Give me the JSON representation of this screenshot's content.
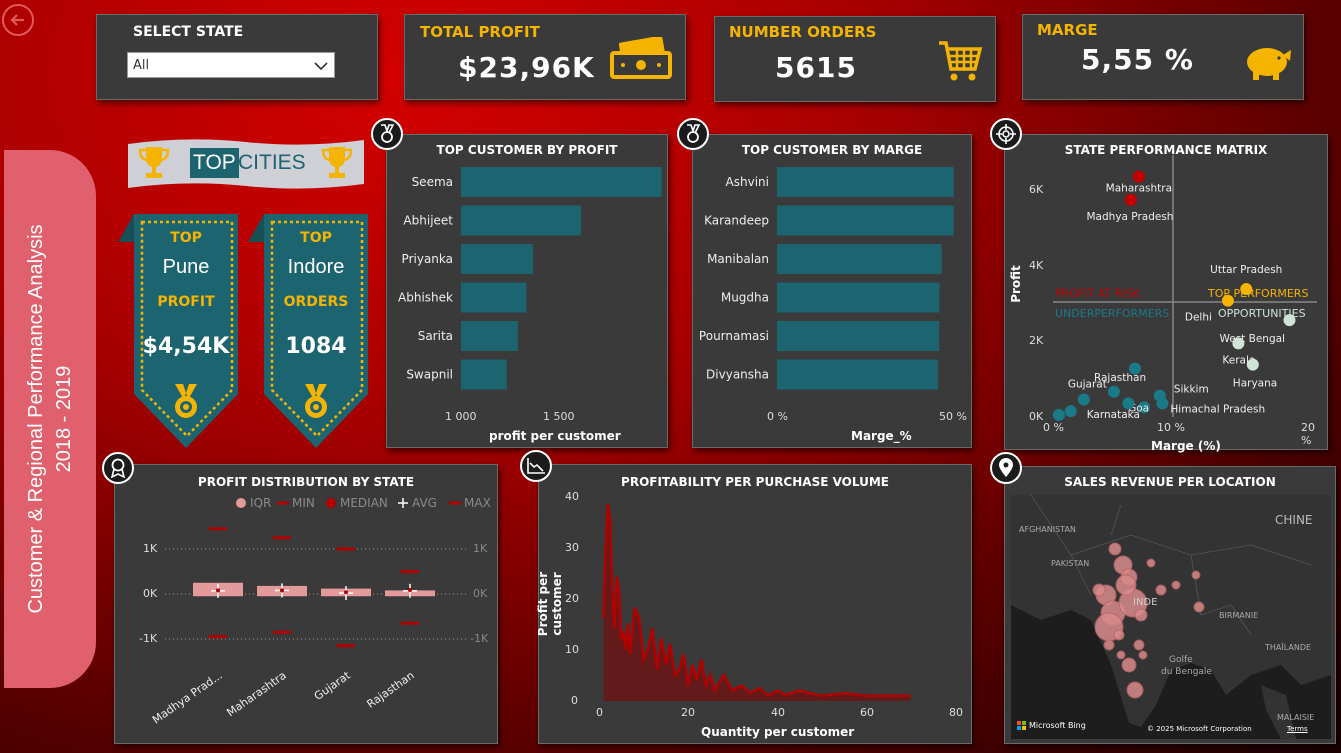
{
  "sidebar": {
    "title_line1": "Customer & Regional Performance Analysis",
    "title_line2": "2018 - 2019"
  },
  "filter": {
    "label": "SELECT STATE",
    "selected": "All"
  },
  "kpis": {
    "profit_label": "TOTAL PROFIT",
    "profit_value": "$23,96K",
    "orders_label": "NUMBER ORDERS",
    "orders_value": "5615",
    "marge_label": "MARGE",
    "marge_value": "5,55 %"
  },
  "top_cities": {
    "banner_top": "TOP",
    "banner_cities": "CITIES",
    "card1": {
      "top": "TOP",
      "city": "Pune",
      "metric": "PROFIT",
      "value": "$4,54K"
    },
    "card2": {
      "top": "TOP",
      "city": "Indore",
      "metric": "ORDERS",
      "value": "1084"
    }
  },
  "colors": {
    "teal": "#1b6470",
    "gold": "#f5b400",
    "dark_red": "#b30000",
    "panel": "#3a3a3a"
  },
  "charts": {
    "profit_by_customer": {
      "title": "TOP CUSTOMER BY PROFIT",
      "xlabel": "profit per customer",
      "ticks": [
        "1 000",
        "1 500"
      ]
    },
    "marge_by_customer": {
      "title": "TOP CUSTOMER BY MARGE",
      "xlabel": "Marge_%",
      "ticks": [
        "0 %",
        "50 %"
      ]
    },
    "matrix": {
      "title": "STATE PERFORMANCE MATRIX",
      "xlabel": "Marge (%)",
      "ylabel": "Profit",
      "yticks": [
        "0K",
        "2K",
        "4K",
        "6K"
      ],
      "xticks": [
        "0 %",
        "10 %",
        "20 %"
      ],
      "quadrants": {
        "risk": "PROFIT AT RISK",
        "top": "TOP PERFORMERS",
        "under": "UNDERPERFORMERS",
        "opp": "OPPORTUNITIES"
      }
    },
    "distribution": {
      "title": "PROFIT DISTRIBUTION BY STATE",
      "legend": [
        "IQR",
        "MIN",
        "MEDIAN",
        "AVG",
        "MAX"
      ],
      "yticks": [
        "1K",
        "0K",
        "-1K"
      ]
    },
    "volume": {
      "title": "PROFITABILITY PER PURCHASE VOLUME",
      "xlabel": "Quantity per customer",
      "ylabel": "Profit per customer",
      "yticks": [
        "40",
        "30",
        "20",
        "10",
        "0"
      ],
      "xticks": [
        "0",
        "20",
        "40",
        "60",
        "80"
      ]
    },
    "map": {
      "title": "SALES REVENUE PER LOCATION",
      "labels": {
        "afghanistan": "AFGHANISTAN",
        "pakistan": "PAKISTAN",
        "chine": "CHINE",
        "inde": "INDE",
        "birmanie": "BIRMANIE",
        "thailande": "THAÏLANDE",
        "golfe1": "Golfe",
        "golfe2": "du Bengale",
        "malaisie": "MALAISIE"
      },
      "bing": "Microsoft Bing",
      "copyright": "© 2025 Microsoft Corporation",
      "terms": "Terms"
    }
  },
  "chart_data": [
    {
      "type": "bar",
      "title": "TOP CUSTOMER BY PROFIT",
      "xlabel": "profit per customer",
      "categories": [
        "Seema",
        "Abhijeet",
        "Priyanka",
        "Abhishek",
        "Sarita",
        "Swapnil"
      ],
      "values": [
        1920,
        1550,
        1330,
        1300,
        1260,
        1210
      ],
      "xlim": [
        1000,
        2000
      ]
    },
    {
      "type": "bar",
      "title": "TOP CUSTOMER BY MARGE",
      "xlabel": "Marge_%",
      "categories": [
        "Ashvini",
        "Karandeep",
        "Manibalan",
        "Mugdha",
        "Pournamasi",
        "Divyansha"
      ],
      "values": [
        49.9,
        49.9,
        46.5,
        45.9,
        45.8,
        45.5
      ],
      "xlim": [
        0,
        50
      ]
    },
    {
      "type": "scatter",
      "title": "STATE PERFORMANCE MATRIX",
      "xlabel": "Marge (%)",
      "ylabel": "Profit",
      "xlim": [
        0,
        20
      ],
      "ylim": [
        0,
        6500
      ],
      "points": [
        {
          "label": "Maharashtra",
          "x": 6.4,
          "y": 6200,
          "color": "#c40000"
        },
        {
          "label": "Madhya Pradesh",
          "x": 5.8,
          "y": 5600,
          "color": "#c40000"
        },
        {
          "label": "Uttar Pradesh",
          "x": 14.6,
          "y": 3300,
          "color": "#f5b400"
        },
        {
          "label": "Delhi",
          "x": 13.2,
          "y": 3000,
          "color": "#f5b400"
        },
        {
          "label": "West Bengal",
          "x": 17.9,
          "y": 2500,
          "color": "#cfe3d6"
        },
        {
          "label": "Kerala",
          "x": 14.0,
          "y": 1900,
          "color": "#cfe3d6"
        },
        {
          "label": "Haryana",
          "x": 15.1,
          "y": 1350,
          "color": "#cfe3d6"
        },
        {
          "label": "Gujarat",
          "x": 2.2,
          "y": 450,
          "color": "#1b7a88"
        },
        {
          "label": "Rajasthan",
          "x": 4.5,
          "y": 650,
          "color": "#1b7a88"
        },
        {
          "label": "",
          "x": 6.1,
          "y": 1250,
          "color": "#1b7a88"
        },
        {
          "label": "Sikkim",
          "x": 8.0,
          "y": 550,
          "color": "#1b7a88"
        },
        {
          "label": "Goa",
          "x": 6.8,
          "y": 250,
          "color": "#1b7a88"
        },
        {
          "label": "Himachal Pradesh",
          "x": 8.2,
          "y": 350,
          "color": "#1b7a88"
        },
        {
          "label": "Karnataka",
          "x": 1.2,
          "y": 150,
          "color": "#1b7a88"
        },
        {
          "label": "",
          "x": 0.3,
          "y": 50,
          "color": "#1b7a88"
        },
        {
          "label": "",
          "x": 5.6,
          "y": 350,
          "color": "#1b7a88"
        }
      ]
    },
    {
      "type": "box",
      "title": "PROFIT DISTRIBUTION BY STATE",
      "categories": [
        "Madhya Prad...",
        "Maharashtra",
        "Gujarat",
        "Rajasthan"
      ],
      "series": [
        {
          "name": "MIN",
          "values": [
            -950,
            -850,
            -1150,
            -650
          ]
        },
        {
          "name": "IQR",
          "values": [
            [
              -50,
              250
            ],
            [
              -50,
              180
            ],
            [
              -50,
              120
            ],
            [
              -50,
              80
            ]
          ]
        },
        {
          "name": "MEDIAN",
          "values": [
            80,
            80,
            40,
            90
          ]
        },
        {
          "name": "AVG",
          "values": [
            70,
            80,
            20,
            70
          ]
        },
        {
          "name": "MAX",
          "values": [
            1450,
            1250,
            1000,
            500
          ]
        }
      ],
      "ylim": [
        -1300,
        1700
      ]
    },
    {
      "type": "area",
      "title": "PROFITABILITY PER PURCHASE VOLUME",
      "xlabel": "Quantity per customer",
      "ylabel": "Profit per customer",
      "xlim": [
        0,
        80
      ],
      "ylim": [
        0,
        42
      ],
      "x": [
        1,
        1.5,
        2,
        2.5,
        3,
        3.5,
        4,
        4.5,
        5,
        5.5,
        6,
        6.5,
        7,
        8,
        9,
        10,
        11,
        12,
        13,
        14,
        15,
        16,
        17,
        18,
        19,
        20,
        21,
        22,
        23,
        24,
        25,
        26,
        28,
        30,
        32,
        34,
        36,
        38,
        40,
        42,
        45,
        50,
        55,
        60,
        65,
        70
      ],
      "values": [
        16,
        30,
        38,
        35,
        21,
        14,
        24,
        21,
        12,
        13,
        10,
        15,
        9,
        18,
        16,
        8,
        10,
        14,
        6,
        12,
        7,
        11,
        5,
        6,
        9,
        3,
        7,
        4,
        8,
        3,
        5,
        2,
        5,
        2,
        3,
        1.5,
        2.5,
        1,
        2,
        1.2,
        2,
        1,
        1.5,
        1,
        1,
        1
      ]
    }
  ]
}
